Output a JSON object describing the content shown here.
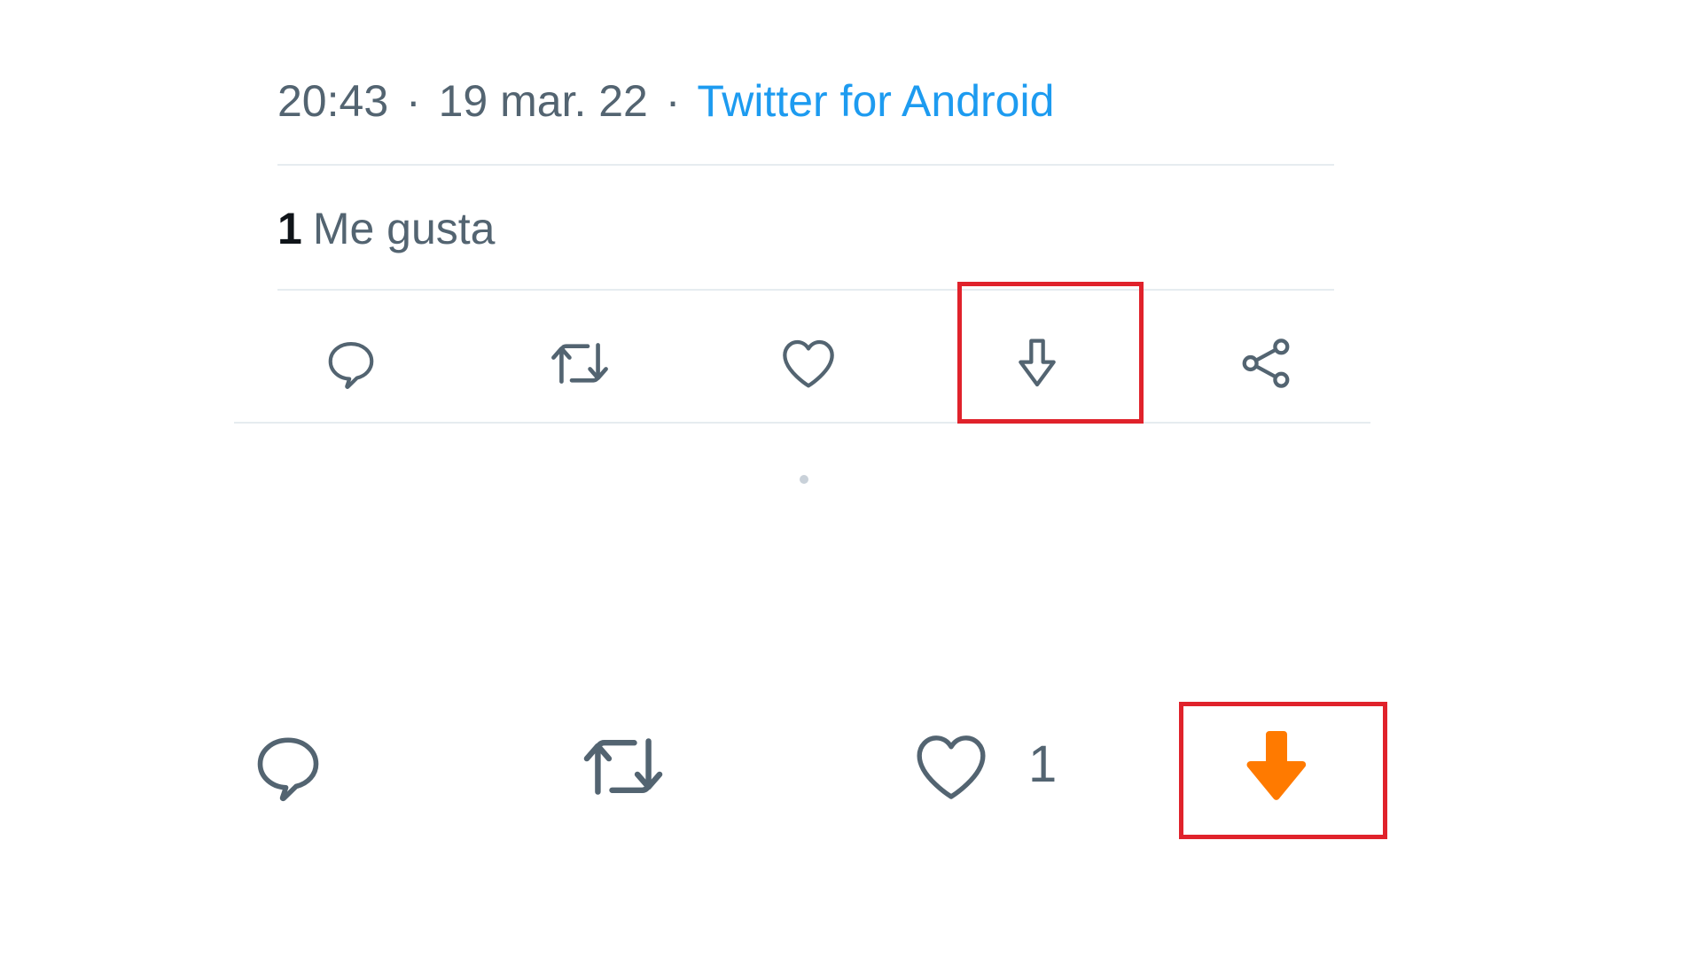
{
  "tweet": {
    "time": "20:43",
    "separator": "·",
    "date": "19 mar. 22",
    "source": "Twitter for Android",
    "likes_count": "1",
    "likes_label": "Me gusta"
  },
  "actions_top": [
    {
      "icon": "reply-icon"
    },
    {
      "icon": "retweet-icon"
    },
    {
      "icon": "like-icon"
    },
    {
      "icon": "download-icon",
      "highlighted": true
    },
    {
      "icon": "share-icon"
    }
  ],
  "actions_bottom": {
    "like_count": "1",
    "download_icon": "download-arrow-icon",
    "download_color": "#ff7a00"
  },
  "colors": {
    "text_secondary": "#536471",
    "link": "#1d9bf0",
    "highlight": "#e0222b",
    "icon": "#536471"
  }
}
